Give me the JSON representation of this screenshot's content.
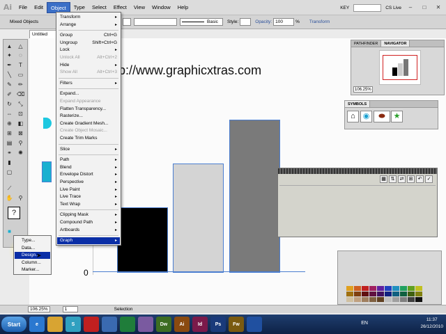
{
  "app": {
    "logo": "Ai"
  },
  "menubar": {
    "items": [
      "File",
      "Edit",
      "Object",
      "Type",
      "Select",
      "Effect",
      "View",
      "Window",
      "Help"
    ],
    "workspace": "KEY",
    "cs_live": "CS Live"
  },
  "controlbar": {
    "selection": "Mixed Objects",
    "stroke_style": "Basic",
    "style_label": "Style:",
    "opacity_label": "Opacity:",
    "opacity_value": "100",
    "opacity_unit": "%",
    "transform": "Transform"
  },
  "document": {
    "tab": "Untitled",
    "url_text": "p://www.graphicxtras.com",
    "zero_label": "0"
  },
  "chart_data": {
    "type": "bar",
    "categories": [
      "",
      "",
      ""
    ],
    "values": [
      49,
      82,
      115
    ],
    "colors": [
      "#000000",
      "#d4d4d4",
      "#7a7a7a"
    ],
    "ylim": [
      0,
      120
    ]
  },
  "object_menu": {
    "items": [
      {
        "label": "Transform",
        "shortcut": "",
        "sub": true,
        "disabled": false
      },
      {
        "label": "Arrange",
        "shortcut": "",
        "sub": true,
        "disabled": false
      },
      {
        "label": "Group",
        "shortcut": "Ctrl+G",
        "sub": false,
        "disabled": false
      },
      {
        "label": "Ungroup",
        "shortcut": "Shift+Ctrl+G",
        "sub": false,
        "disabled": false
      },
      {
        "label": "Lock",
        "shortcut": "",
        "sub": true,
        "disabled": false
      },
      {
        "label": "Unlock All",
        "shortcut": "Alt+Ctrl+2",
        "sub": false,
        "disabled": true
      },
      {
        "label": "Hide",
        "shortcut": "",
        "sub": true,
        "disabled": false
      },
      {
        "label": "Show All",
        "shortcut": "Alt+Ctrl+3",
        "sub": false,
        "disabled": true
      },
      {
        "label": "Filters",
        "shortcut": "",
        "sub": true,
        "disabled": false
      },
      {
        "label": "Expand...",
        "shortcut": "",
        "sub": false,
        "disabled": false
      },
      {
        "label": "Expand Appearance",
        "shortcut": "",
        "sub": false,
        "disabled": true
      },
      {
        "label": "Flatten Transparency...",
        "shortcut": "",
        "sub": false,
        "disabled": false
      },
      {
        "label": "Rasterize...",
        "shortcut": "",
        "sub": false,
        "disabled": false
      },
      {
        "label": "Create Gradient Mesh...",
        "shortcut": "",
        "sub": false,
        "disabled": false
      },
      {
        "label": "Create Object Mosaic...",
        "shortcut": "",
        "sub": false,
        "disabled": true
      },
      {
        "label": "Create Trim Marks",
        "shortcut": "",
        "sub": false,
        "disabled": false
      },
      {
        "label": "Slice",
        "shortcut": "",
        "sub": true,
        "disabled": false
      },
      {
        "label": "Path",
        "shortcut": "",
        "sub": true,
        "disabled": false
      },
      {
        "label": "Blend",
        "shortcut": "",
        "sub": true,
        "disabled": false
      },
      {
        "label": "Envelope Distort",
        "shortcut": "",
        "sub": true,
        "disabled": false
      },
      {
        "label": "Perspective",
        "shortcut": "",
        "sub": true,
        "disabled": false
      },
      {
        "label": "Live Paint",
        "shortcut": "",
        "sub": true,
        "disabled": false
      },
      {
        "label": "Live Trace",
        "shortcut": "",
        "sub": true,
        "disabled": false
      },
      {
        "label": "Text Wrap",
        "shortcut": "",
        "sub": true,
        "disabled": false
      },
      {
        "label": "Clipping Mask",
        "shortcut": "",
        "sub": true,
        "disabled": false
      },
      {
        "label": "Compound Path",
        "shortcut": "",
        "sub": true,
        "disabled": false
      },
      {
        "label": "Artboards",
        "shortcut": "",
        "sub": true,
        "disabled": false
      },
      {
        "label": "Graph",
        "shortcut": "",
        "sub": true,
        "disabled": false,
        "highlighted": true
      }
    ]
  },
  "graph_submenu": {
    "items": [
      {
        "label": "Type..."
      },
      {
        "label": "Data..."
      },
      {
        "label": "Design...",
        "highlighted": true
      },
      {
        "label": "Column..."
      },
      {
        "label": "Marker..."
      }
    ]
  },
  "panels": {
    "pathfinder_tab": "PATHFINDER",
    "navigator_tab": "NAVIGATOR",
    "navigator_zoom": "106.25%",
    "symbols_tab": "SYMBOLS"
  },
  "statusbar": {
    "zoom": "106.25%",
    "artboard": "1",
    "tool": "Selection"
  },
  "taskbar": {
    "start": "Start",
    "lang": "EN",
    "time": "11:37",
    "date": "26/12/2010",
    "apps": [
      {
        "label": "e",
        "color": "#2a78d0"
      },
      {
        "label": "",
        "color": "#d8a432"
      },
      {
        "label": "S",
        "color": "#30a0c0"
      },
      {
        "label": "",
        "color": "#c02020"
      },
      {
        "label": "",
        "color": "#3a6ab0"
      },
      {
        "label": "",
        "color": "#1f7d3a"
      },
      {
        "label": "",
        "color": "#7a5aa0"
      },
      {
        "label": "Dw",
        "color": "#3d6d22"
      },
      {
        "label": "Ai",
        "color": "#8a4a10"
      },
      {
        "label": "Id",
        "color": "#7a1a4a"
      },
      {
        "label": "Ps",
        "color": "#1a3a7a"
      },
      {
        "label": "Fw",
        "color": "#7a5a10"
      },
      {
        "label": "",
        "color": "#2050a0"
      }
    ]
  }
}
